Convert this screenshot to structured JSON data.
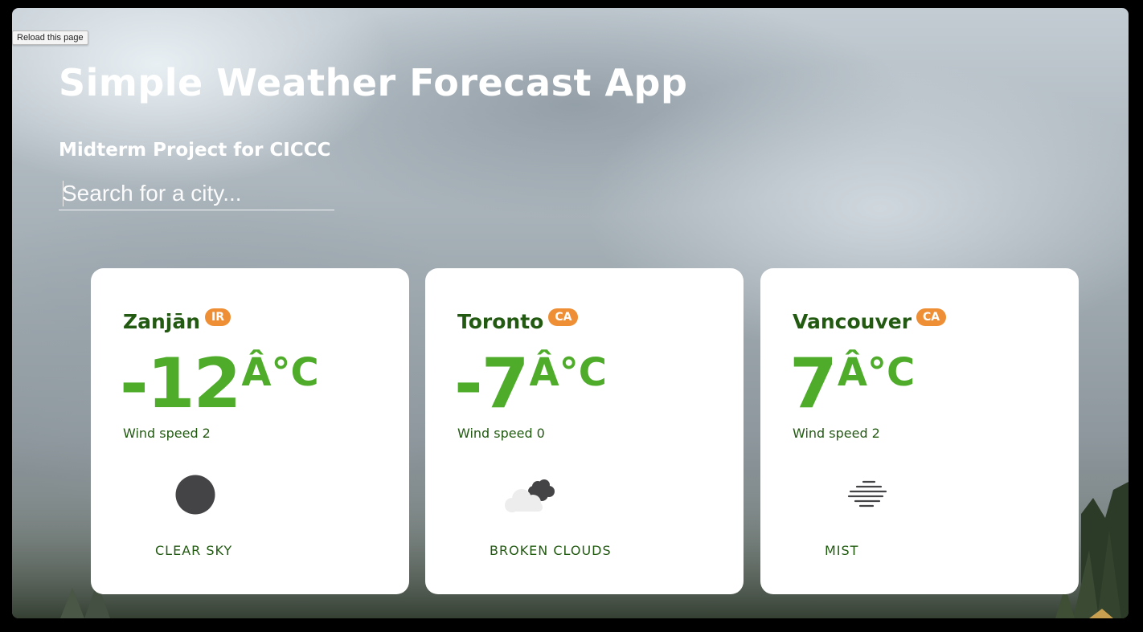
{
  "tooltip": {
    "text": "Reload this page"
  },
  "app": {
    "title": "Simple Weather Forecast App",
    "subtitle": "Midterm Project for CICCC"
  },
  "search": {
    "placeholder": "Search for a city...",
    "value": ""
  },
  "cards": [
    {
      "city": "Zanjān",
      "country": "IR",
      "temp": "-12",
      "unit": "Â°C",
      "wind_label": "Wind speed",
      "wind_value": "2",
      "icon": "clear-sky-icon",
      "description": "CLEAR SKY"
    },
    {
      "city": "Toronto",
      "country": "CA",
      "temp": "-7",
      "unit": "Â°C",
      "wind_label": "Wind speed",
      "wind_value": "0",
      "icon": "broken-clouds-icon",
      "description": "BROKEN CLOUDS"
    },
    {
      "city": "Vancouver",
      "country": "CA",
      "temp": "7",
      "unit": "Â°C",
      "wind_label": "Wind speed",
      "wind_value": "2",
      "icon": "mist-icon",
      "description": "MIST"
    }
  ],
  "colors": {
    "city_text": "#225a12",
    "temperature": "#4eac2a",
    "country_badge": "#ee8f35",
    "card_background": "#ffffff"
  }
}
